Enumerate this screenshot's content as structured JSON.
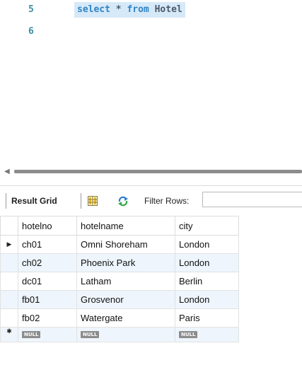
{
  "editor": {
    "lines": [
      {
        "number": "5",
        "text_parts": {
          "kw1": "select",
          "mid": " * ",
          "kw2": "from",
          "tail": " Hotel"
        }
      },
      {
        "number": "6"
      }
    ]
  },
  "toolbar": {
    "result_grid_label": "Result Grid",
    "filter_label": "Filter Rows:",
    "filter_value": ""
  },
  "grid": {
    "columns": [
      "hotelno",
      "hotelname",
      "city"
    ],
    "rows": [
      {
        "hotelno": "ch01",
        "hotelname": "Omni Shoreham",
        "city": "London",
        "current": true
      },
      {
        "hotelno": "ch02",
        "hotelname": "Phoenix Park",
        "city": "London"
      },
      {
        "hotelno": "dc01",
        "hotelname": "Latham",
        "city": "Berlin"
      },
      {
        "hotelno": "fb01",
        "hotelname": "Grosvenor",
        "city": "London"
      },
      {
        "hotelno": "fb02",
        "hotelname": "Watergate",
        "city": "Paris"
      }
    ],
    "current_row_marker": "▶",
    "new_row_marker": "✱",
    "null_label": "NULL"
  }
}
